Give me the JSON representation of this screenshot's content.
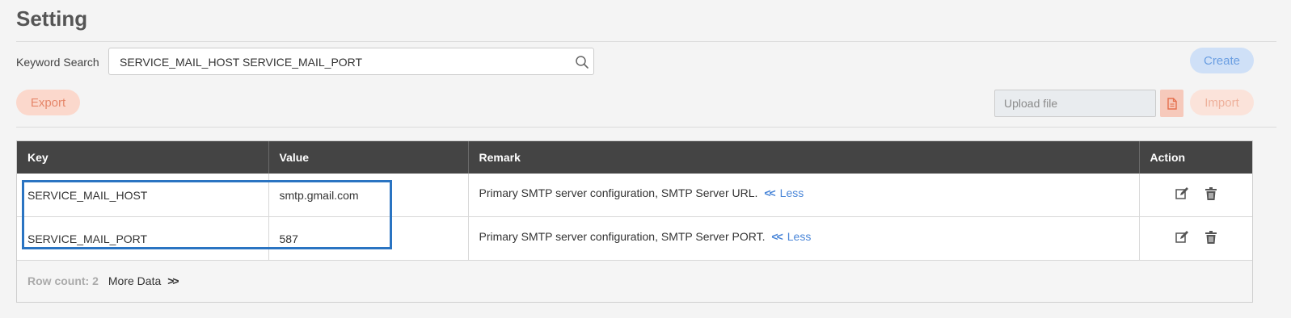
{
  "page": {
    "title": "Setting"
  },
  "search": {
    "label": "Keyword Search",
    "value": "SERVICE_MAIL_HOST SERVICE_MAIL_PORT",
    "icon": "search-icon"
  },
  "toolbar": {
    "create_label": "Create",
    "export_label": "Export",
    "import_label": "Import",
    "upload_placeholder": "Upload file",
    "file_icon": "file-icon"
  },
  "table": {
    "columns": [
      "Key",
      "Value",
      "Remark",
      "Action"
    ],
    "rows": [
      {
        "key": "SERVICE_MAIL_HOST",
        "value": "smtp.gmail.com",
        "remark": "Primary SMTP server configuration, SMTP Server URL.",
        "less_label": "Less"
      },
      {
        "key": "SERVICE_MAIL_PORT",
        "value": "587",
        "remark": "Primary SMTP server configuration, SMTP Server PORT.",
        "less_label": "Less"
      }
    ],
    "row_count_label": "Row count: 2",
    "more_data_label": "More Data"
  },
  "colors": {
    "header_bg": "#444444",
    "accent_blue": "#4a86d8",
    "highlight_border": "#2a74c2",
    "export_bg": "#fbd8cc",
    "create_bg": "#cfe0f7"
  }
}
